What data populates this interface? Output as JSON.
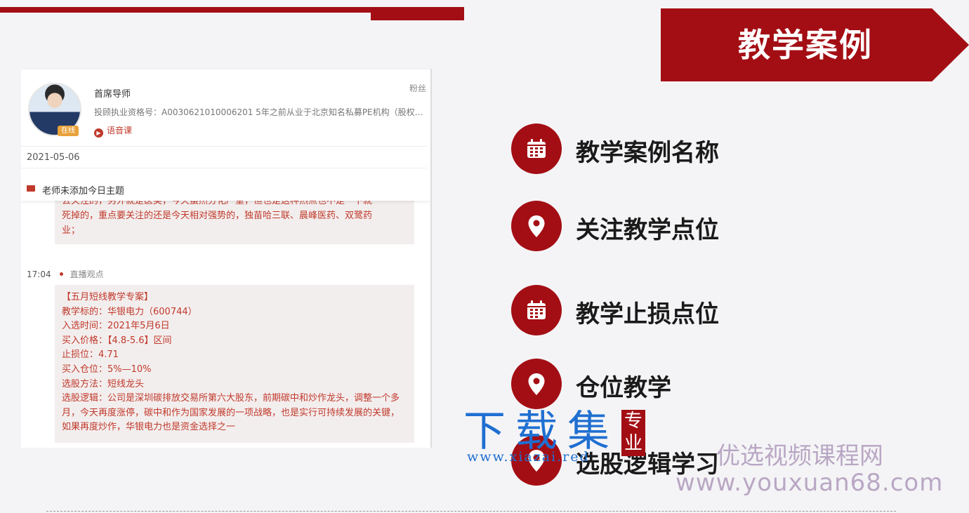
{
  "banner": {
    "title": "教学案例"
  },
  "profile": {
    "mentor_label": "首席导师",
    "fans_label": "粉丝",
    "certificate": "投顾执业资格号：A0030621010006201 5年之前从业于北京知名私募PE机构（股权收...",
    "online_badge": "在线",
    "voice_course": "语音课"
  },
  "feed": {
    "date": "2021-05-06",
    "topic_notice": "老师未添加今日主题",
    "msg1_lines": [
      "去关注的，另外就是医美，今天虽然分化严重，但也是这种热点也不是一下就",
      "死掉的，重点要关注的还是今天相对强势的，独苗哈三联、晨峰医药、双鹭药",
      "业；"
    ],
    "msg2_time": "17:04",
    "msg2_tag": "直播观点",
    "msg2_lines": [
      "【五月短线教学专案】",
      "教学标的：华银电力（600744）",
      "入选时间：2021年5月6日",
      "买入价格：【4.8-5.6】区间",
      "止损位：4.71",
      "买入仓位：5%—10%",
      "选股方法：短线龙头",
      "选股逻辑：公司是深圳碳排放交易所第六大股东，前期碳中和炒作龙头，调整一个多月，今天再度涨停，碳中和作为国家发展的一项战略，也是实行可持续发展的关键，如果再度炒作，华银电力也是资金选择之一"
    ]
  },
  "items": [
    {
      "label": "教学案例名称",
      "icon": "calendar-icon"
    },
    {
      "label": "关注教学点位",
      "icon": "location-pin-icon"
    },
    {
      "label": "教学止损点位",
      "icon": "calendar-icon"
    },
    {
      "label": "仓位教学",
      "icon": "location-pin-icon"
    },
    {
      "label": "选股逻辑学习",
      "icon": "location-pin-icon"
    }
  ],
  "watermarks": {
    "xiazaiji": "下载集",
    "zhuanye": "专业",
    "xiazai_url": "www.xiazai.red",
    "youxuan_cn": "优选视频课程网",
    "youxuan_url": "www.youxuan68.com"
  },
  "colors": {
    "brand_red": "#a30e14",
    "text_red": "#c0392b"
  }
}
